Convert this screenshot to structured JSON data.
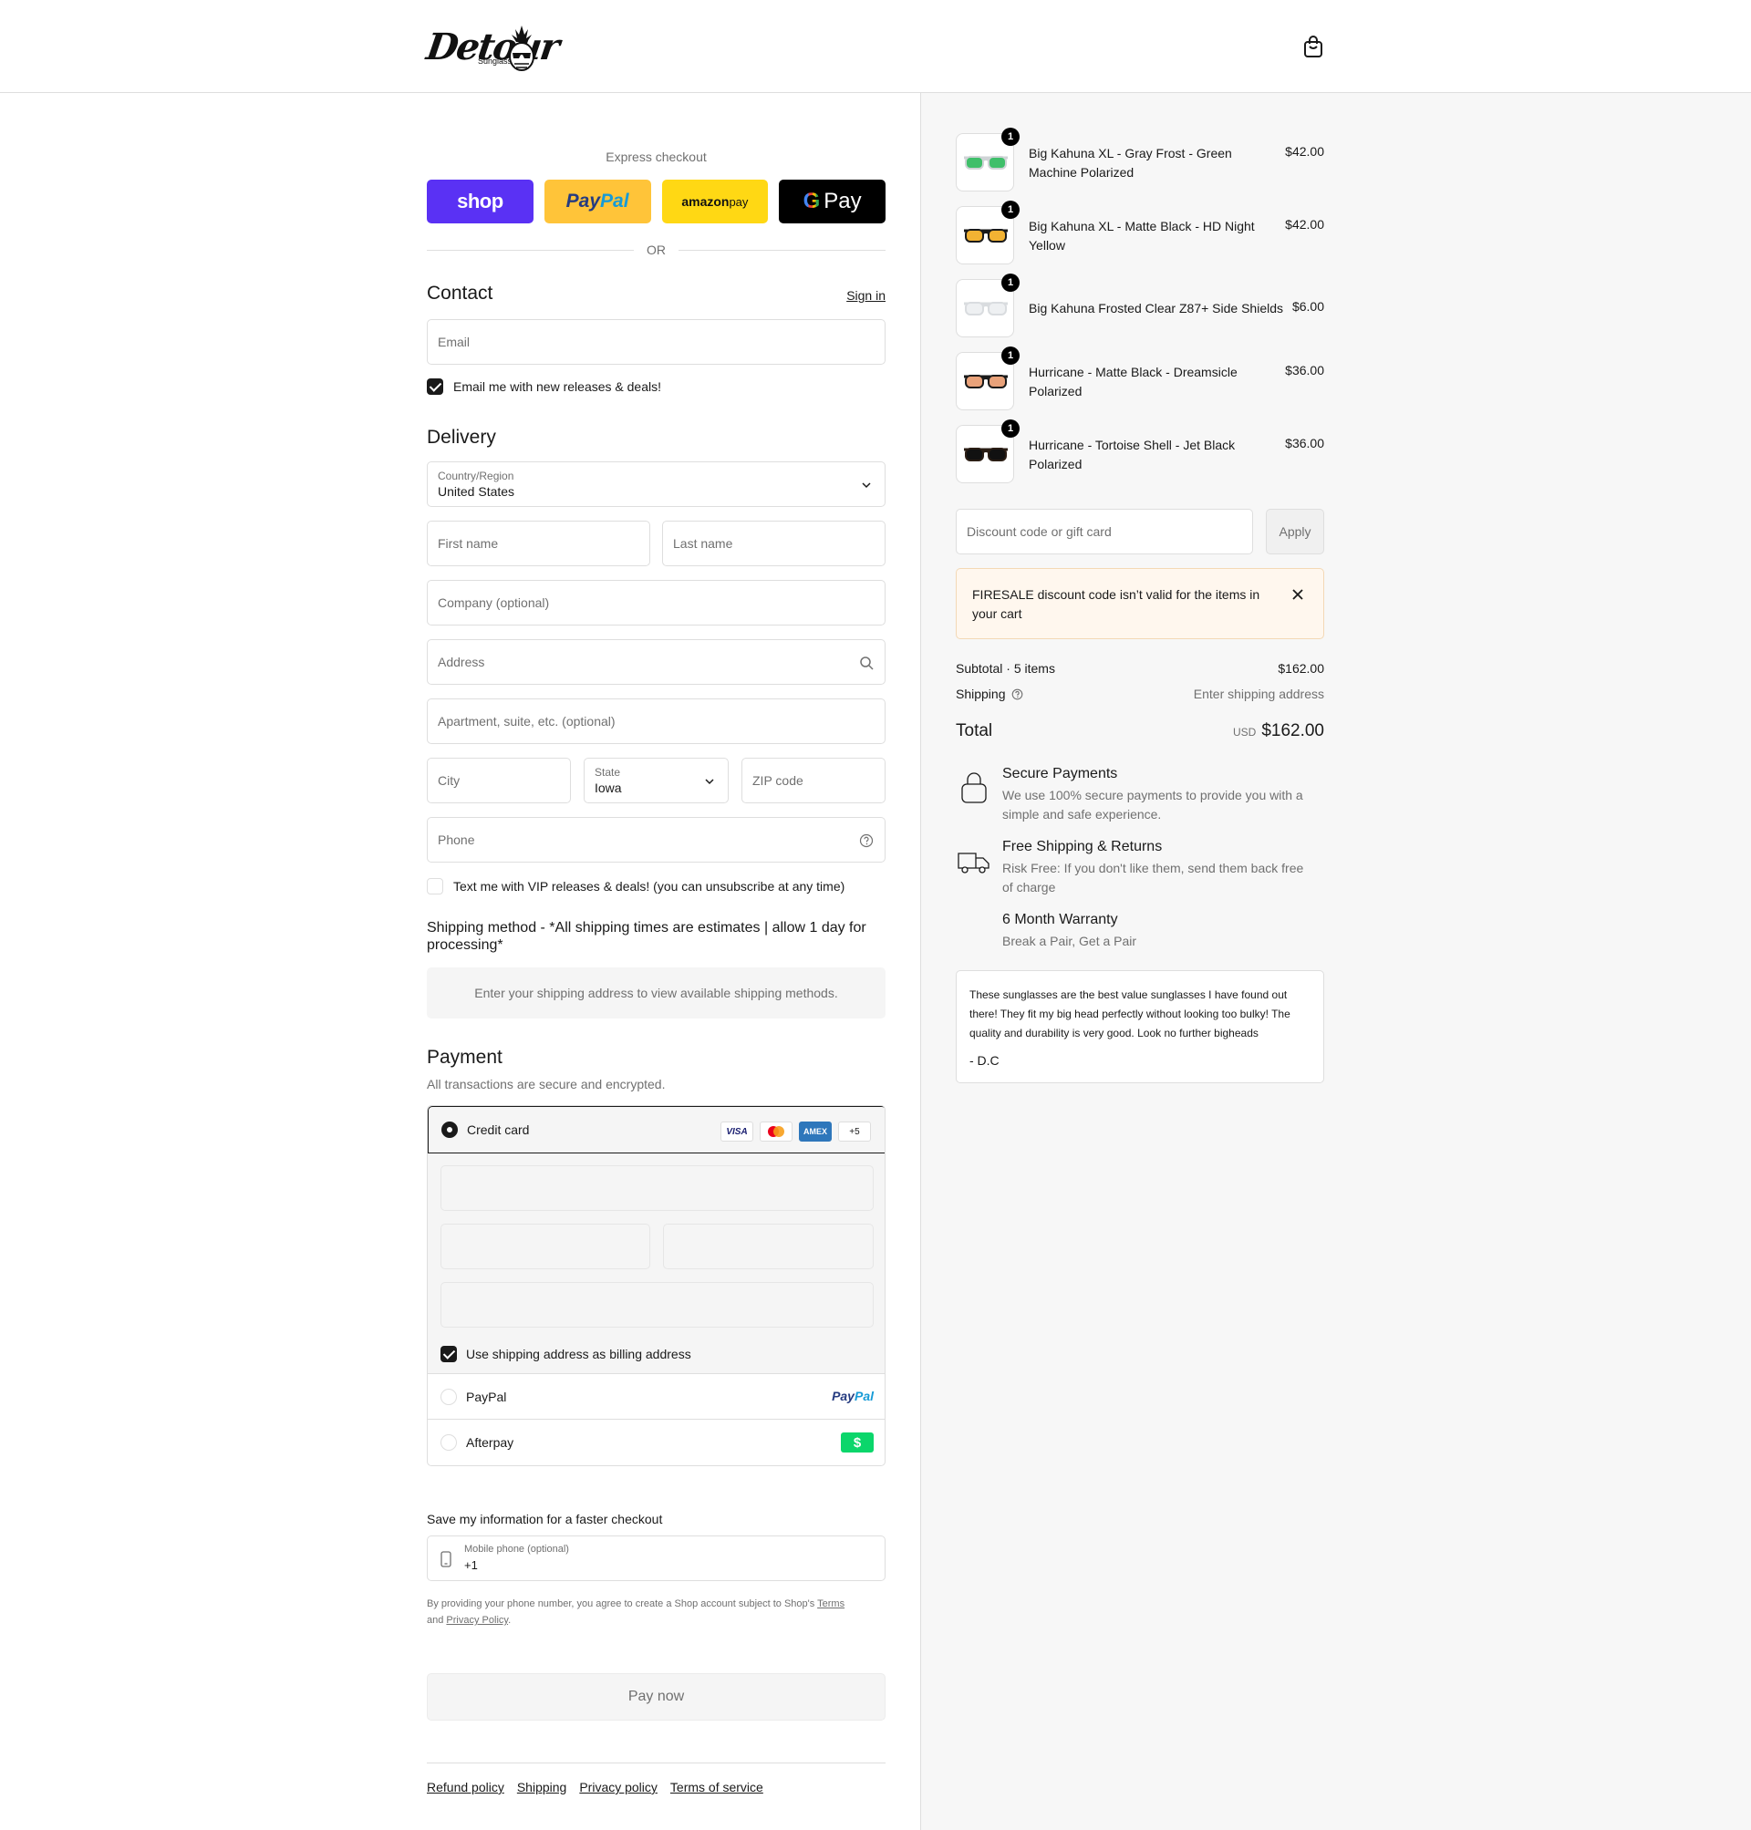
{
  "brand": {
    "logo_text": "Detour",
    "logo_sub": "Sunglasses"
  },
  "express": {
    "label": "Express checkout",
    "shop": "shop",
    "paypal_a": "Pay",
    "paypal_b": "Pal",
    "amazon_a": "amazon",
    "amazon_b": " pay",
    "gpay": "Pay",
    "or": "OR"
  },
  "contact": {
    "title": "Contact",
    "sign_in": "Sign in",
    "email_placeholder": "Email",
    "newsletter": "Email me with new releases & deals!"
  },
  "delivery": {
    "title": "Delivery",
    "country_label": "Country/Region",
    "country_value": "United States",
    "first_name": "First name",
    "last_name": "Last name",
    "company": "Company (optional)",
    "address": "Address",
    "apartment": "Apartment, suite, etc. (optional)",
    "city": "City",
    "state_label": "State",
    "state_value": "Iowa",
    "zip": "ZIP code",
    "phone": "Phone",
    "sms": "Text me with VIP releases & deals! (you can unsubscribe at any time)"
  },
  "shipping_method": {
    "title": "Shipping method - *All shipping times are estimates | allow 1 day for processing*",
    "notice": "Enter your shipping address to view available shipping methods."
  },
  "payment": {
    "title": "Payment",
    "subtitle": "All transactions are secure and encrypted.",
    "credit_card": "Credit card",
    "card_badges": [
      "VISA",
      "",
      "AMEX",
      "+5"
    ],
    "billing_same": "Use shipping address as billing address",
    "paypal": "PayPal",
    "paypal_logo_a": "Pay",
    "paypal_logo_b": "Pal",
    "afterpay": "Afterpay",
    "afterpay_logo": "$"
  },
  "save_info": {
    "title": "Save my information for a faster checkout",
    "phone_label": "Mobile phone (optional)",
    "phone_value": "+1",
    "legal_a": "By providing your phone number, you agree to create a Shop account subject to Shop's ",
    "legal_terms": "Terms",
    "legal_and": "and ",
    "legal_privacy": "Privacy Policy",
    "legal_end": "."
  },
  "pay_now": "Pay now",
  "footer": [
    "Refund policy",
    "Shipping",
    "Privacy policy",
    "Terms of service"
  ],
  "cart": {
    "items": [
      {
        "qty": "1",
        "name": "Big Kahuna XL - Gray Frost - Green Machine Polarized",
        "price": "$42.00",
        "frame": "#cfd3d6",
        "lens": "#3fbf6a"
      },
      {
        "qty": "1",
        "name": "Big Kahuna XL - Matte Black - HD Night Yellow",
        "price": "$42.00",
        "frame": "#1a1a1a",
        "lens": "#f2b233"
      },
      {
        "qty": "1",
        "name": "Big Kahuna Frosted Clear Z87+ Side Shields",
        "price": "$6.00",
        "frame": "#d9dcdf",
        "lens": "#eef0f2"
      },
      {
        "qty": "1",
        "name": "Hurricane - Matte Black - Dreamsicle Polarized",
        "price": "$36.00",
        "frame": "#1a1a1a",
        "lens": "#e9a27a"
      },
      {
        "qty": "1",
        "name": "Hurricane - Tortoise Shell - Jet Black Polarized",
        "price": "$36.00",
        "frame": "#2a1d14",
        "lens": "#111111"
      }
    ],
    "discount_placeholder": "Discount code or gift card",
    "apply": "Apply",
    "error": "FIRESALE discount code isn’t valid for the items in your cart",
    "subtotal_label": "Subtotal · 5 items",
    "subtotal_value": "$162.00",
    "shipping_label": "Shipping",
    "shipping_value": "Enter shipping address",
    "total_label": "Total",
    "total_currency": "USD",
    "total_value": "$162.00"
  },
  "features": [
    {
      "title": "Secure Payments",
      "desc": "We use 100% secure payments to provide you with a simple and safe experience."
    },
    {
      "title": "Free Shipping & Returns",
      "desc": "Risk Free: If you don't like them, send them back free of charge"
    },
    {
      "title": "6 Month Warranty",
      "desc": "Break a Pair, Get a Pair"
    }
  ],
  "review": {
    "text": "These sunglasses are the best value sunglasses I have found out there! They fit my big head perfectly without looking too bulky! The quality and durability is very good. Look no further bigheads",
    "author": "- D.C"
  },
  "colors": {
    "shop": "#5a31f4",
    "paypal": "#ffc439",
    "amazon": "#ffd814",
    "afterpay": "#0bd66b"
  }
}
